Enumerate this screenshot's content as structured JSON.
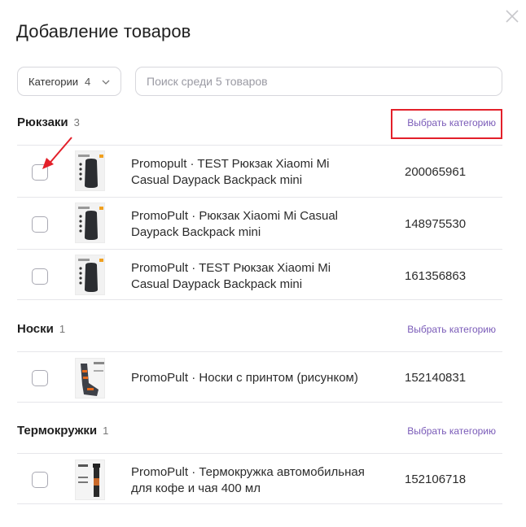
{
  "modal": {
    "title": "Добавление товаров",
    "close_icon": "close-icon"
  },
  "filters": {
    "category_label": "Категории",
    "category_count": "4",
    "search_placeholder": "Поиск среди 5 товаров",
    "search_value": ""
  },
  "categories": [
    {
      "name": "Рюкзаки",
      "count": "3",
      "select_label": "Выбрать категорию",
      "products": [
        {
          "name_line1": "Promopult · TEST Рюкзак Xiaomi Mi",
          "name_line2": "Casual Daypack Backpack mini",
          "id": "200065961"
        },
        {
          "name_line1": "PromoPult · Рюкзак Xiaomi Mi Casual",
          "name_line2": "Daypack Backpack mini",
          "id": "148975530"
        },
        {
          "name_line1": "PromoPult · TEST Рюкзак Xiaomi Mi",
          "name_line2": "Casual Daypack Backpack mini",
          "id": "161356863"
        }
      ]
    },
    {
      "name": "Носки",
      "count": "1",
      "select_label": "Выбрать категорию",
      "products": [
        {
          "name_line1": "PromoPult · Носки с принтом (рисунком)",
          "name_line2": "",
          "id": "152140831"
        }
      ]
    },
    {
      "name": "Термокружки",
      "count": "1",
      "select_label": "Выбрать категорию",
      "products": [
        {
          "name_line1": "PromoPult · Термокружка автомобильная",
          "name_line2": "для кофе и чая 400 мл",
          "id": "152106718"
        }
      ]
    }
  ],
  "annotation": {
    "highlight_color": "#e3202a",
    "arrow_color": "#e3202a"
  }
}
